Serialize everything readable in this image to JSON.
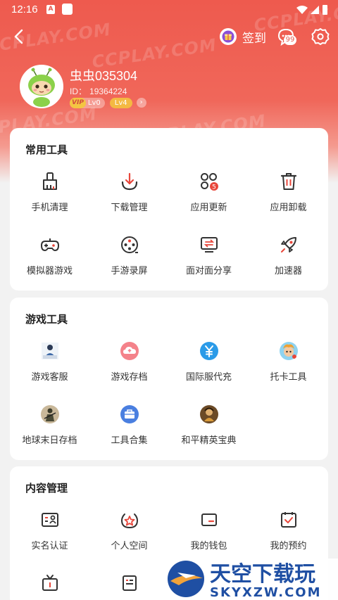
{
  "status_bar": {
    "time": "12:16",
    "notif_icon_label": "A"
  },
  "header": {
    "watermark": "CCPLAY.COM",
    "checkin_label": "签到",
    "message_count": "99"
  },
  "profile": {
    "username": "虫虫035304",
    "id_label": "ID：",
    "id_value": "19364224",
    "vip_label": "VIP",
    "vip_level": "Lv0",
    "user_level": "Lv4"
  },
  "sections": {
    "common_tools": {
      "title": "常用工具",
      "items": [
        {
          "label": "手机清理",
          "icon": "broom-icon"
        },
        {
          "label": "下载管理",
          "icon": "download-icon"
        },
        {
          "label": "应用更新",
          "icon": "app-update-icon",
          "badge": "5"
        },
        {
          "label": "应用卸载",
          "icon": "trash-icon"
        },
        {
          "label": "模拟器游戏",
          "icon": "gamepad-icon"
        },
        {
          "label": "手游录屏",
          "icon": "record-icon"
        },
        {
          "label": "面对面分享",
          "icon": "share-icon"
        },
        {
          "label": "加速器",
          "icon": "rocket-icon"
        }
      ]
    },
    "game_tools": {
      "title": "游戏工具",
      "items": [
        {
          "label": "游戏客服",
          "icon": "customer-service-icon"
        },
        {
          "label": "游戏存档",
          "icon": "cloud-save-icon"
        },
        {
          "label": "国际服代充",
          "icon": "yen-icon"
        },
        {
          "label": "托卡工具",
          "icon": "toca-icon"
        },
        {
          "label": "地球末日存档",
          "icon": "soldier-icon"
        },
        {
          "label": "工具合集",
          "icon": "toolbox-icon"
        },
        {
          "label": "和平精英宝典",
          "icon": "pubg-icon"
        }
      ]
    },
    "content_management": {
      "title": "内容管理",
      "items": [
        {
          "label": "实名认证",
          "icon": "id-card-icon"
        },
        {
          "label": "个人空间",
          "icon": "star-badge-icon"
        },
        {
          "label": "我的钱包",
          "icon": "wallet-icon"
        },
        {
          "label": "我的预约",
          "icon": "calendar-check-icon"
        },
        {
          "label": "",
          "icon": "tv-icon"
        },
        {
          "label": "",
          "icon": "document-icon"
        }
      ]
    }
  },
  "bottom_watermark": {
    "cn": "天空下载玩",
    "en": "SKYXZW.COM"
  },
  "colors": {
    "accent": "#ee5a4e",
    "icon_stroke": "#333333",
    "text": "#333333"
  }
}
